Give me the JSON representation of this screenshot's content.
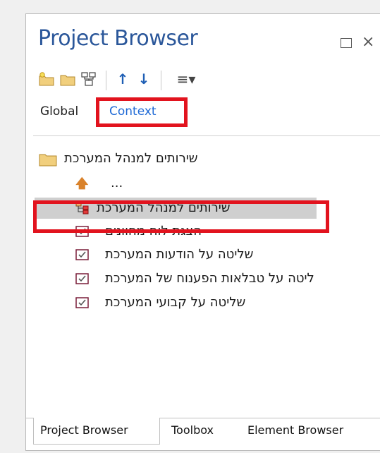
{
  "window": {
    "title": "Project Browser",
    "maximize_icon": "maximize-icon",
    "close_icon": "close-icon",
    "close_glyph": "×"
  },
  "toolbar": {
    "icons": [
      "new-package-icon",
      "new-folder-icon",
      "new-diagram-icon",
      "move-up-icon",
      "move-down-icon",
      "menu-icon"
    ],
    "up_glyph": "↑",
    "down_glyph": "↓",
    "menu_glyph": "≡▾"
  },
  "scope": {
    "global_label": "Global",
    "context_label": "Context"
  },
  "tree": {
    "root_label": "שירותים למנהל המערכת",
    "up_label": "...",
    "items": [
      {
        "label": "שירותים למנהל המערכת",
        "icon": "diagram-icon",
        "selected": true
      },
      {
        "label": "הצגת לוח מחוונים",
        "icon": "use-case-icon"
      },
      {
        "label": "שליטה על הודעות המערכת",
        "icon": "use-case-icon"
      },
      {
        "label": "ליטה על טבלאות הפענוח של המערכת",
        "icon": "use-case-icon"
      },
      {
        "label": "שליטה על קבועי המערכת",
        "icon": "use-case-icon"
      }
    ]
  },
  "bottom_tabs": {
    "project_browser": "Project Browser",
    "toolbox": "Toolbox",
    "element_browser": "Element Browser"
  },
  "colors": {
    "title": "#2b579a",
    "highlight": "#e2131e",
    "selected_row": "#cfcfcf",
    "folder": "#e8c370"
  }
}
